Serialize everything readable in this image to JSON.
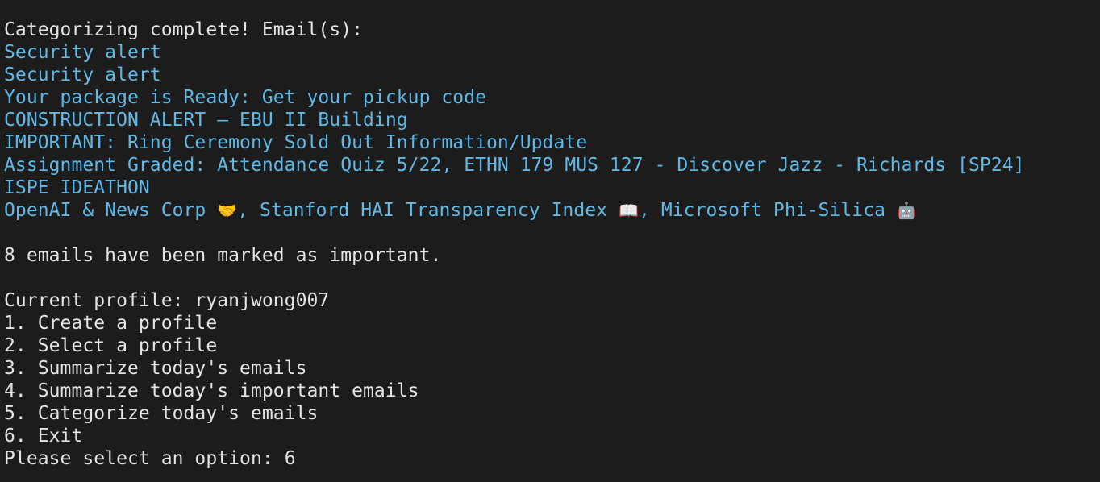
{
  "terminal": {
    "status_line": "Categorizing complete! Email(s):",
    "emails": [
      "Security alert",
      "Security alert",
      "Your package is Ready: Get your pickup code",
      "CONSTRUCTION ALERT – EBU II Building",
      "IMPORTANT: Ring Ceremony Sold Out Information/Update",
      "Assignment Graded: Attendance Quiz 5/22, ETHN 179 MUS 127 - Discover Jazz - Richards [SP24]",
      "ISPE IDEATHON"
    ],
    "newsletter": {
      "part1": "OpenAI & News Corp ",
      "emoji1": "🤝",
      "part2": ", Stanford HAI Transparency Index ",
      "emoji2": "📖",
      "part3": ", Microsoft Phi-Silica ",
      "emoji3": "🤖"
    },
    "marked_message": "8 emails have been marked as important.",
    "current_profile": "Current profile: ryanjwong007",
    "menu": [
      "1. Create a profile",
      "2. Select a profile",
      "3. Summarize today's emails",
      "4. Summarize today's important emails",
      "5. Categorize today's emails",
      "6. Exit"
    ],
    "prompt": "Please select an option: ",
    "input_value": "6"
  },
  "colors": {
    "background": "#1c1c1c",
    "text": "#e4e4e4",
    "email_text": "#5fb8e6"
  }
}
